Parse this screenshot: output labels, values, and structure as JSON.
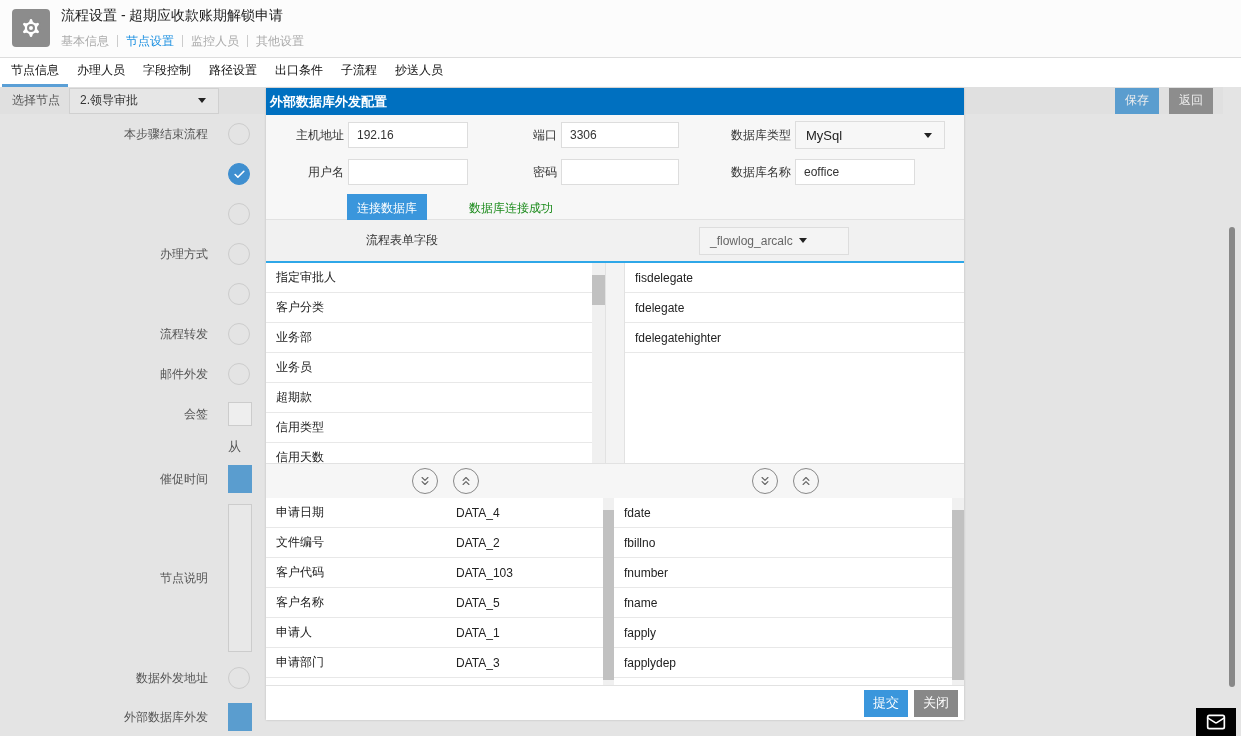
{
  "header": {
    "title": "流程设置 - 超期应收款账期解锁申请",
    "nav": [
      {
        "label": "基本信息",
        "selected": false
      },
      {
        "label": "节点设置",
        "selected": true
      },
      {
        "label": "监控人员",
        "selected": false
      },
      {
        "label": "其他设置",
        "selected": false
      }
    ]
  },
  "tabs": [
    {
      "label": "节点信息",
      "selected": true
    },
    {
      "label": "办理人员",
      "selected": false
    },
    {
      "label": "字段控制",
      "selected": false
    },
    {
      "label": "路径设置",
      "selected": false
    },
    {
      "label": "出口条件",
      "selected": false
    },
    {
      "label": "子流程",
      "selected": false
    },
    {
      "label": "抄送人员",
      "selected": false
    }
  ],
  "node_select": {
    "label": "选择节点",
    "value": "2.领导审批"
  },
  "actions": [
    {
      "label": "保存",
      "kind": "primary"
    },
    {
      "label": "返回",
      "kind": "secondary"
    }
  ],
  "form_rows": [
    {
      "label": "本步骤结束流程",
      "kind": "radio",
      "checked": false
    },
    {
      "kind": "radio",
      "checked": true
    },
    {
      "kind": "radio",
      "checked": false
    },
    {
      "label": "办理方式",
      "kind": "radio",
      "checked": false
    },
    {
      "kind": "radio",
      "checked": false
    },
    {
      "label": "流程转发",
      "kind": "radio",
      "checked": false
    },
    {
      "label": "邮件外发",
      "kind": "radio",
      "checked": false
    },
    {
      "label": "会签",
      "kind": "box",
      "checked": false
    },
    {
      "kind": "text",
      "text": "从"
    },
    {
      "label": "催促时间",
      "kind": "stub"
    },
    {
      "label": "节点说明",
      "kind": "editor"
    },
    {
      "label": "数据外发地址",
      "kind": "radio",
      "checked": false
    },
    {
      "label": "外部数据库外发",
      "kind": "stub"
    }
  ],
  "dialog": {
    "title": "外部数据库外发配置",
    "fields": [
      {
        "label": "主机地址",
        "kind": "input",
        "value": "192.16"
      },
      {
        "label": "端口",
        "kind": "input",
        "value": "3306"
      },
      {
        "label": "数据库类型",
        "kind": "select",
        "value": "MySql"
      },
      {
        "label": "用户名",
        "kind": "input"
      },
      {
        "label": "密码",
        "kind": "input"
      },
      {
        "label": "数据库名称",
        "kind": "input",
        "value": "eoffice"
      }
    ],
    "connect_button": "连接数据库",
    "status": "数据库连接成功",
    "mapping_label": "流程表单字段",
    "table_select": "_flowlog_arcalc",
    "form_fields": [
      "指定审批人",
      "客户分类",
      "业务部",
      "业务员",
      "超期款",
      "信用类型",
      "信用天数"
    ],
    "db_columns": [
      "fisdelegate",
      "fdelegate",
      "fdelegatehighter"
    ],
    "mappings": [
      {
        "field": "申请日期",
        "data": "DATA_4",
        "column": "fdate"
      },
      {
        "field": "文件编号",
        "data": "DATA_2",
        "column": "fbillno"
      },
      {
        "field": "客户代码",
        "data": "DATA_103",
        "column": "fnumber"
      },
      {
        "field": "客户名称",
        "data": "DATA_5",
        "column": "fname"
      },
      {
        "field": "申请人",
        "data": "DATA_1",
        "column": "fapply"
      },
      {
        "field": "申请部门",
        "data": "DATA_3",
        "column": "fapplydep"
      }
    ],
    "buttons": [
      {
        "label": "提交",
        "kind": "primary"
      },
      {
        "label": "关闭",
        "kind": "secondary"
      }
    ]
  }
}
